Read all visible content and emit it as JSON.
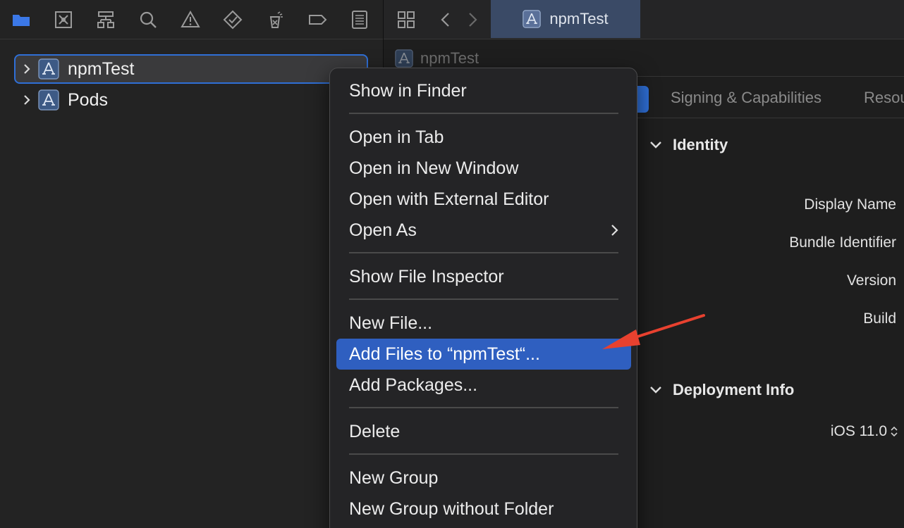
{
  "navigator": {
    "toolbar_icons": [
      "folder-icon",
      "source-control-icon",
      "hierarchy-icon",
      "search-icon",
      "warning-icon",
      "test-icon",
      "debug-icon",
      "breakpoint-icon",
      "report-icon"
    ],
    "tree": [
      {
        "label": "npmTest",
        "selected": true
      },
      {
        "label": "Pods",
        "selected": false
      }
    ]
  },
  "editor": {
    "active_tab": "npmTest",
    "jumpbar": "npmTest",
    "settings_tabs": {
      "signing": "Signing & Capabilities",
      "resources": "Resou"
    },
    "identity": {
      "title": "Identity",
      "display_name": "Display Name",
      "bundle_identifier": "Bundle Identifier",
      "version": "Version",
      "build": "Build"
    },
    "deployment": {
      "title": "Deployment Info",
      "ios_version": "iOS 11.0"
    }
  },
  "context_menu": {
    "items": [
      "Show in Finder",
      "Open in Tab",
      "Open in New Window",
      "Open with External Editor",
      "Open As",
      "Show File Inspector",
      "New File...",
      "Add Files to “npmTest“...",
      "Add Packages...",
      "Delete",
      "New Group",
      "New Group without Folder"
    ],
    "highlighted": "Add Files to “npmTest“..."
  },
  "colors": {
    "selection_blue": "#2f6fd6",
    "menu_highlight": "#2f5fc0",
    "annotation_red": "#e8412f"
  }
}
